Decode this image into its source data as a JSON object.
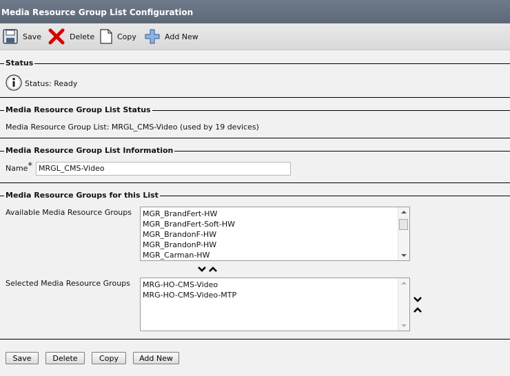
{
  "page": {
    "title": "Media Resource Group List Configuration"
  },
  "toolbar": {
    "save_label": "Save",
    "delete_label": "Delete",
    "copy_label": "Copy",
    "add_new_label": "Add New"
  },
  "status_section": {
    "heading": "Status",
    "text": "Status: Ready"
  },
  "list_status_section": {
    "heading": "Media Resource Group List Status",
    "text": "Media Resource Group List: MRGL_CMS-Video (used by 19 devices)"
  },
  "info_section": {
    "heading": "Media Resource Group List Information",
    "name_label": "Name",
    "required_marker": "*",
    "name_value": "MRGL_CMS-Video"
  },
  "groups_section": {
    "heading": "Media Resource Groups for this List",
    "available_label": "Available Media Resource Groups",
    "available_items": [
      "MGR_BrandFert-HW",
      "MGR_BrandFert-Soft-HW",
      "MGR_BrandonF-HW",
      "MGR_BrandonP-HW",
      "MGR_Carman-HW"
    ],
    "selected_label": "Selected Media Resource Groups",
    "selected_items": [
      "MRG-HO-CMS-Video",
      "MRG-HO-CMS-Video-MTP"
    ]
  },
  "footer": {
    "save_label": "Save",
    "delete_label": "Delete",
    "copy_label": "Copy",
    "add_new_label": "Add New"
  }
}
